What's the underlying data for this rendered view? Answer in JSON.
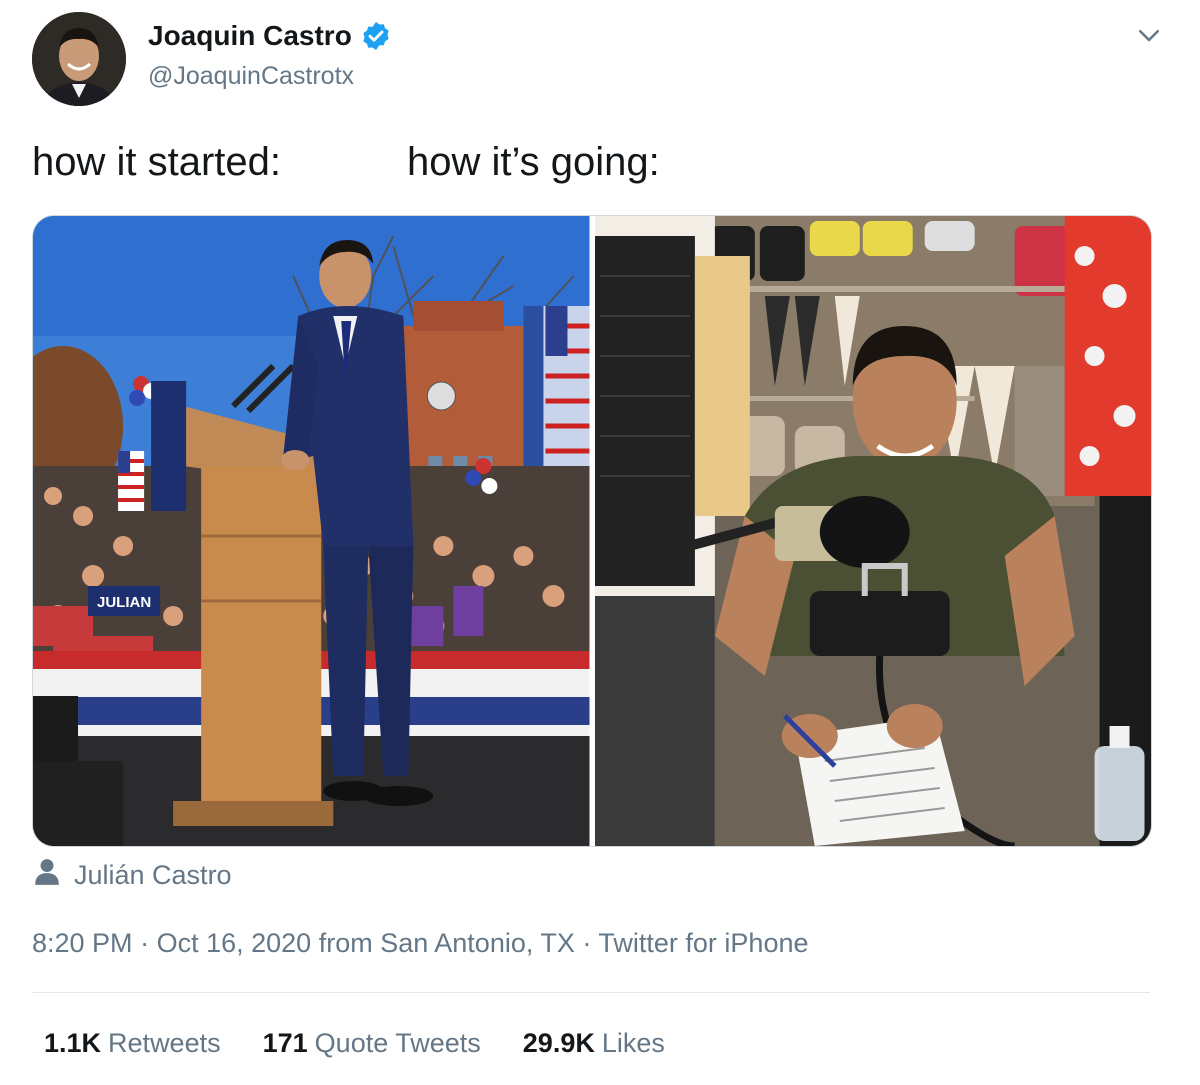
{
  "author": {
    "display_name": "Joaquin Castro",
    "handle": "@JoaquinCastrotx",
    "verified": true,
    "verified_color": "#1da1f2"
  },
  "tweet": {
    "text_left": "how it started:",
    "text_right": "how it’s going:",
    "images": [
      {
        "icon": "photo-podium-rally",
        "sign_text": "JULIAN"
      },
      {
        "icon": "photo-closet-podcast"
      }
    ],
    "tagged_user": "Julián Castro",
    "time": "8:20 PM",
    "date": "Oct 16, 2020",
    "location_prefix": "from",
    "location": "San Antonio, TX",
    "source": "Twitter for iPhone"
  },
  "stats": {
    "retweets_count": "1.1K",
    "retweets_label": "Retweets",
    "quotes_count": "171",
    "quotes_label": "Quote Tweets",
    "likes_count": "29.9K",
    "likes_label": "Likes"
  },
  "icons": {
    "more": "chevron-down-icon",
    "tag": "person-icon"
  },
  "colors": {
    "text_primary": "#14171a",
    "text_secondary": "#657786",
    "border": "#e1e8ed"
  }
}
